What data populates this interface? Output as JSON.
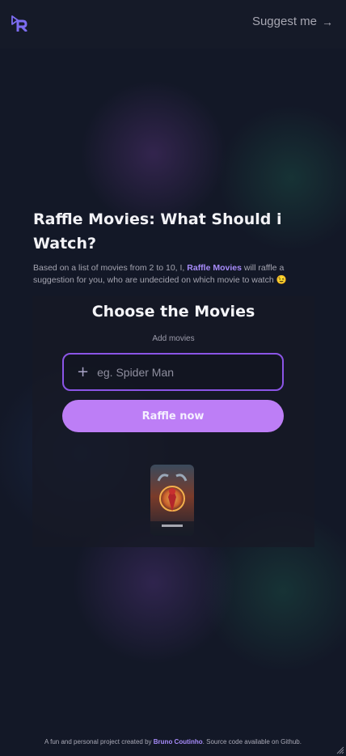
{
  "header": {
    "logo_letter": "R",
    "suggest_label": "Suggest me",
    "suggest_arrow": "→"
  },
  "hero": {
    "title": "Raffle Movies: What Should i Watch?",
    "desc_before": "Based on a list of movies from 2 to 10, I, ",
    "desc_brand": "Raffle Movies",
    "desc_after": " will raffle a suggestion for you, who are undecided on which movie to watch 😉"
  },
  "card": {
    "title": "Choose the Movies",
    "subtitle": "Add movies",
    "input_placeholder": "eg. Spider Man",
    "input_value": "",
    "plus_icon": "+",
    "raffle_button": "Raffle now",
    "poster_icon": "movie-poster"
  },
  "footer": {
    "text_before": "A fun and personal project created by ",
    "author": "Bruno Coutinho",
    "text_after": ". Source code available on Github."
  },
  "colors": {
    "accent": "#a78bfa",
    "button": "#bd7ef6",
    "input_border": "#8b55e6",
    "background": "#131827"
  }
}
